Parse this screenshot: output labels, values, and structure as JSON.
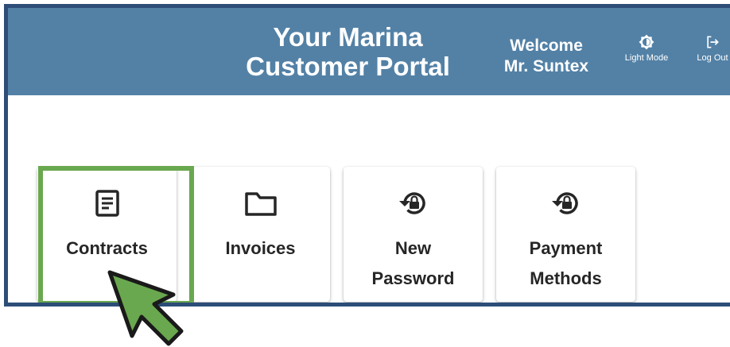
{
  "header": {
    "title_line1": "Your Marina",
    "title_line2": "Customer Portal",
    "welcome_line1": "Welcome",
    "welcome_line2": "Mr. Suntex",
    "light_mode": {
      "label": "Light Mode",
      "icon": "brightness-icon"
    },
    "log_out": {
      "label": "Log Out",
      "icon": "logout-icon"
    },
    "background_color": "#5381a6"
  },
  "tiles": [
    {
      "label": "Contracts",
      "icon": "document-icon"
    },
    {
      "label": "Invoices",
      "icon": "folder-icon"
    },
    {
      "label_line1": "New",
      "label_line2": "Password",
      "icon": "lock-reset-icon"
    },
    {
      "label_line1": "Payment",
      "label_line2": "Methods",
      "icon": "lock-reset-icon"
    }
  ],
  "highlight_color": "#6aa84f",
  "frame_color": "#2d4d78"
}
